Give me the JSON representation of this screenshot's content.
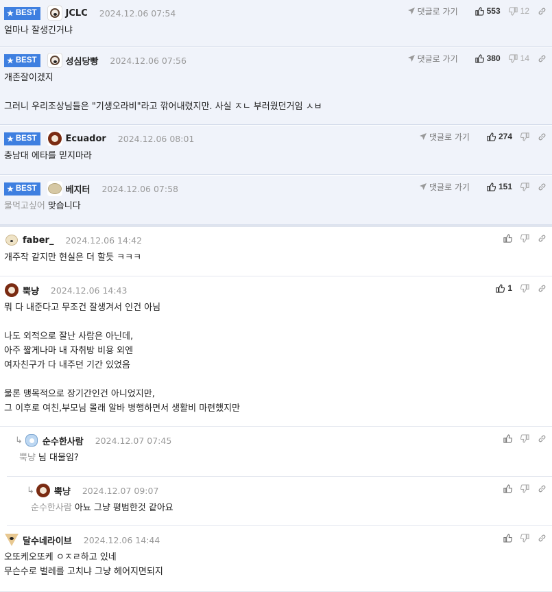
{
  "labels": {
    "best": "BEST",
    "goto": "댓글로 가기"
  },
  "comments": [
    {
      "best": true,
      "avatar": "dog-avatar",
      "nick": "JCLC",
      "date": "2024.12.06 07:54",
      "up": "553",
      "down": "12",
      "mention": "",
      "lines": [
        "얼마나 잘생긴거냐"
      ]
    },
    {
      "best": true,
      "avatar": "dog-avatar",
      "nick": "성심당빵",
      "date": "2024.12.06 07:56",
      "up": "380",
      "down": "14",
      "mention": "",
      "lines": [
        "개존잘이겠지",
        "",
        "그러니 우리조상님들은 \"기생오라비\"라고 깎어내렸지만. 사실 ㅈㄴ 부러웠던거임 ㅅㅂ"
      ]
    },
    {
      "best": true,
      "avatar": "lion-avatar",
      "nick": "Ecuador",
      "date": "2024.12.06 08:01",
      "up": "274",
      "down": "",
      "mention": "",
      "lines": [
        "충남대 에타를 믿지마라"
      ]
    },
    {
      "best": true,
      "avatar": "potato-avatar",
      "nick": "베지터",
      "date": "2024.12.06 07:58",
      "up": "151",
      "down": "",
      "mention": "물먹고싶어",
      "lines": [
        "맞습니다"
      ]
    },
    {
      "best": false,
      "avatar": "puppy-avatar",
      "nick": "faber_",
      "date": "2024.12.06 14:42",
      "up": "",
      "down": "",
      "mention": "",
      "lines": [
        "개주작 같지만 현실은 더 할듯 ㅋㅋㅋ"
      ]
    },
    {
      "best": false,
      "avatar": "lion-avatar",
      "nick": "뿍냥",
      "date": "2024.12.06 14:43",
      "up": "1",
      "down": "",
      "mention": "",
      "lines": [
        "뭐 다 내준다고 무조건 잘생겨서 인건 아님",
        "",
        "나도 외적으로 잘난 사람은 아닌데,",
        "아주 짧게나마 내 자취방 비용 외엔",
        "여자친구가 다 내주던 기간 있었음",
        "",
        "물론 맹목적으로 장기간인건 아니었지만,",
        "그 이후로 여친,부모님 몰래 알바 병행하면서 생활비 마련했지만"
      ]
    },
    {
      "best": false,
      "avatar": "blue-avatar",
      "nick": "순수한사람",
      "date": "2024.12.07 07:45",
      "up": "",
      "down": "",
      "mention": "뿍냥",
      "mention_suffix": "님",
      "lines": [
        "대물임?"
      ]
    },
    {
      "best": false,
      "avatar": "lion-avatar",
      "nick": "뿍냥",
      "date": "2024.12.07 09:07",
      "up": "",
      "down": "",
      "mention": "순수한사람",
      "lines": [
        "아뇨 그냥 평범한것 같아요"
      ]
    },
    {
      "best": false,
      "avatar": "chihuahua-avatar",
      "nick": "달수네라이브",
      "date": "2024.12.06 14:44",
      "up": "",
      "down": "",
      "mention": "",
      "lines": [
        "오또케오또케 ㅇㅈㄹ하고 있네",
        "무슨수로 벌레를 고치냐 그냥 헤어지면되지"
      ]
    }
  ]
}
